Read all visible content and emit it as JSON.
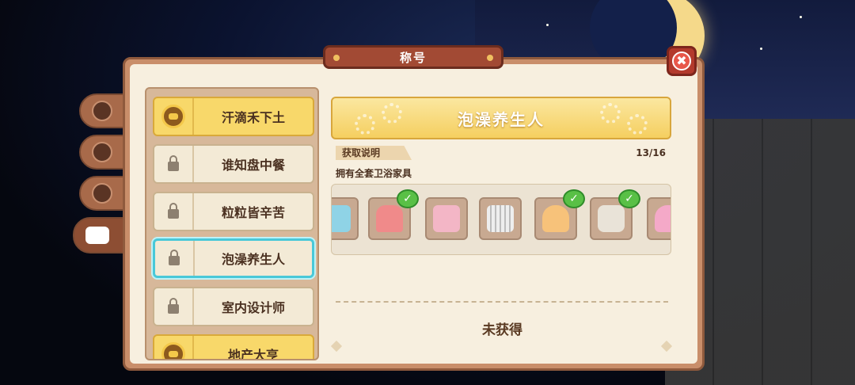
{
  "header": {
    "title": "称号"
  },
  "titles": [
    {
      "label": "汗滴禾下土",
      "state": "owned"
    },
    {
      "label": "谁知盘中餐",
      "state": "locked"
    },
    {
      "label": "粒粒皆辛苦",
      "state": "locked"
    },
    {
      "label": "泡澡养生人",
      "state": "locked",
      "selected": true
    },
    {
      "label": "室内设计师",
      "state": "locked"
    },
    {
      "label": "地产大亨",
      "state": "owned"
    }
  ],
  "detail": {
    "name": "泡澡养生人",
    "howto_label": "获取说明",
    "progress": "13/16",
    "description": "拥有全套卫浴家具",
    "status": "未获得",
    "items": [
      {
        "icon": "bath-set-icon",
        "owned": false
      },
      {
        "icon": "mirror-cabinet-icon",
        "owned": true
      },
      {
        "icon": "washing-machine-icon",
        "owned": false
      },
      {
        "icon": "radiator-icon",
        "owned": false
      },
      {
        "icon": "cupcake-icon",
        "owned": true
      },
      {
        "icon": "reed-diffuser-icon",
        "owned": true
      },
      {
        "icon": "cake-icon",
        "owned": false
      }
    ]
  },
  "side_tabs": [
    {
      "icon": "sun-icon"
    },
    {
      "icon": "book-icon"
    },
    {
      "icon": "star-icon"
    },
    {
      "icon": "title-icon",
      "active": true
    }
  ],
  "colors": {
    "accent_gold": "#f8d86a",
    "selected_outline": "#49c8d8",
    "owned_check": "#59c046"
  }
}
